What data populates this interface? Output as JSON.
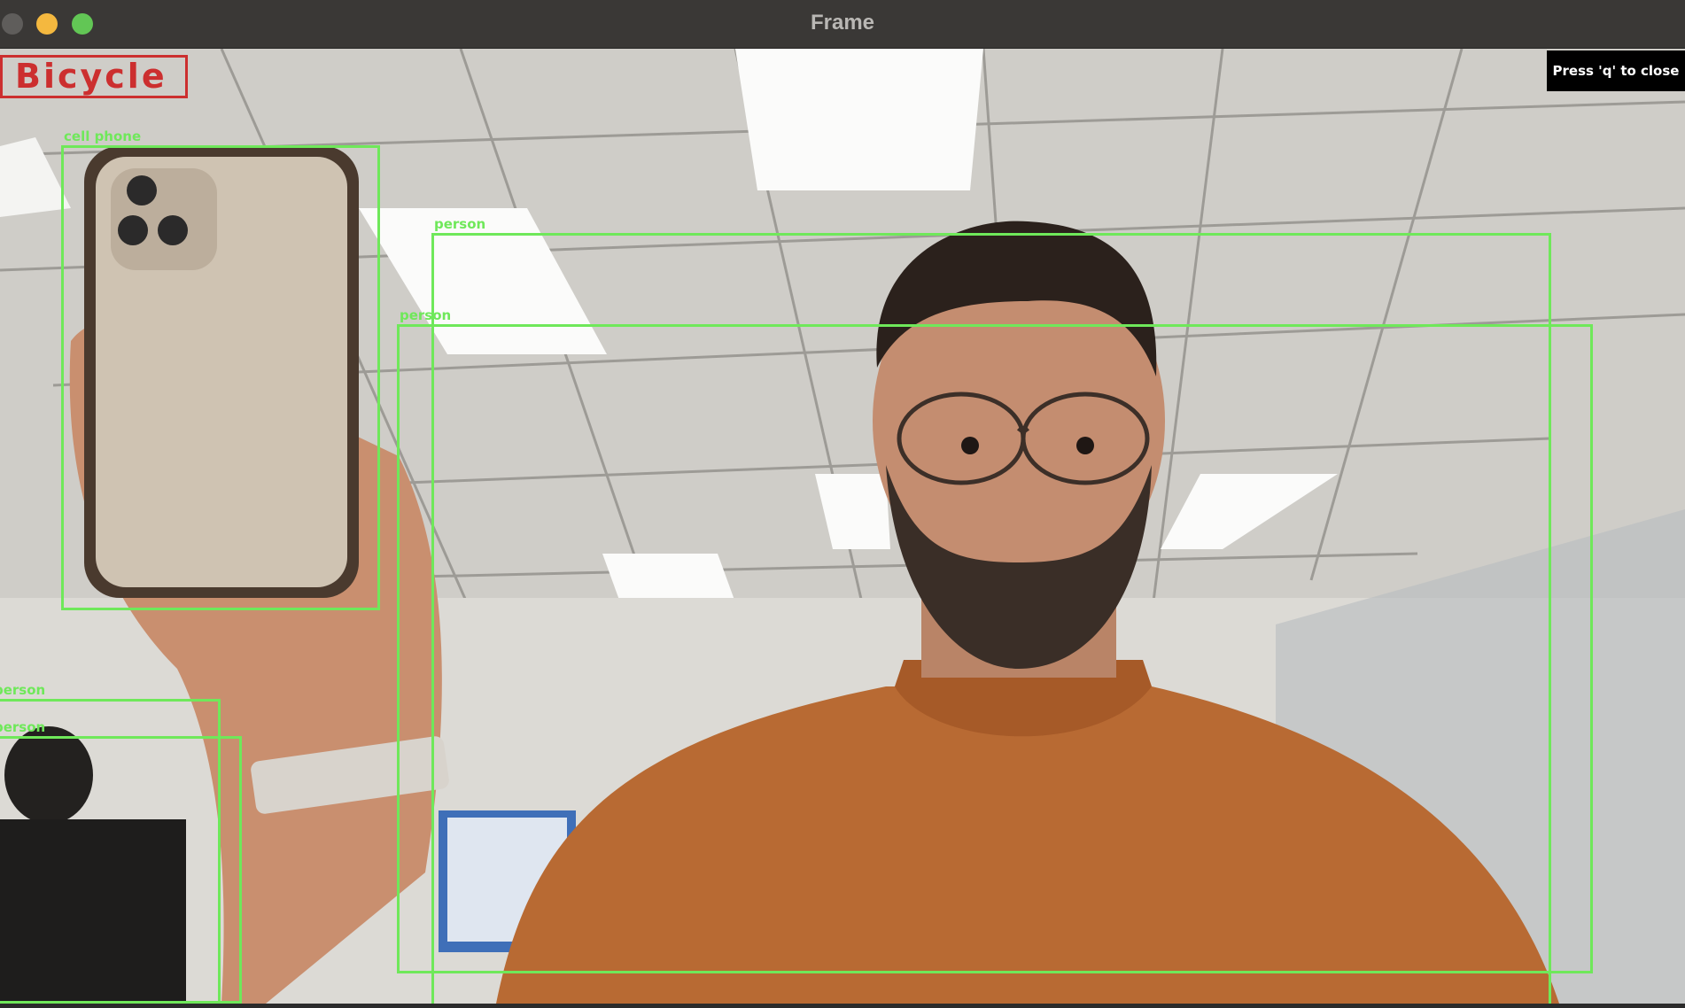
{
  "window": {
    "title": "Frame"
  },
  "overlay": {
    "close_hint": "Press 'q' to close",
    "classification": "Bicycle"
  },
  "detections": [
    {
      "label": "cell phone"
    },
    {
      "label": "person"
    },
    {
      "label": "person"
    },
    {
      "label": "person"
    },
    {
      "label": "person"
    }
  ],
  "colors": {
    "detection_box": "#6fe85a",
    "classification_text": "#cc2f2f",
    "close_button": "#5f5d5b",
    "minimize_button": "#f4b83f",
    "maximize_button": "#62c655"
  }
}
